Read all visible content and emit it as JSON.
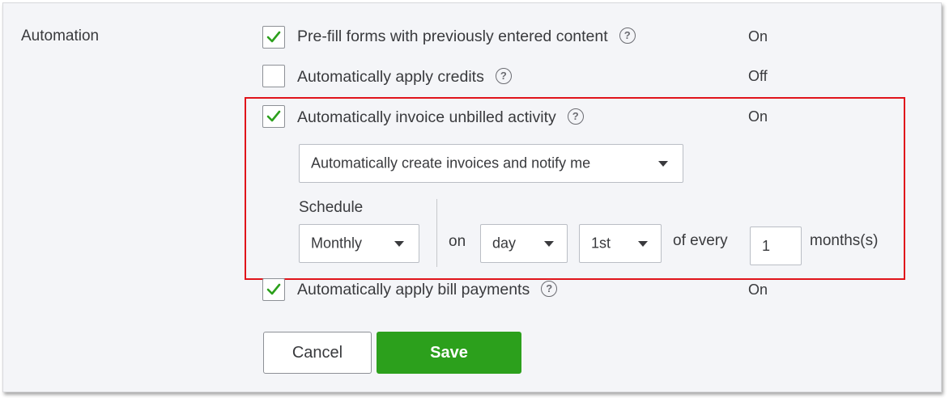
{
  "section": {
    "label": "Automation"
  },
  "options": [
    {
      "label": "Pre-fill forms with previously entered content",
      "checked": true,
      "status": "On"
    },
    {
      "label": "Automatically apply credits",
      "checked": false,
      "status": "Off"
    },
    {
      "label": "Automatically invoice unbilled activity",
      "checked": true,
      "status": "On"
    },
    {
      "label": "Automatically apply bill payments",
      "checked": true,
      "status": "On"
    }
  ],
  "help_glyph": "?",
  "invoice_mode": {
    "selected": "Automatically create invoices and notify me"
  },
  "schedule": {
    "label": "Schedule",
    "frequency": "Monthly",
    "on_label": "on",
    "unit": "day",
    "day": "1st",
    "of_every_label": "of every",
    "interval": "1",
    "months_label": "months(s)"
  },
  "buttons": {
    "cancel": "Cancel",
    "save": "Save"
  },
  "colors": {
    "check": "#2ca01c",
    "save": "#2ca01c",
    "highlight": "#e0141b",
    "panel": "#f4f5f8"
  },
  "icons": {
    "checkmark": "checkmark-icon",
    "help": "help-circle-icon",
    "dropdown": "caret-down-icon"
  }
}
